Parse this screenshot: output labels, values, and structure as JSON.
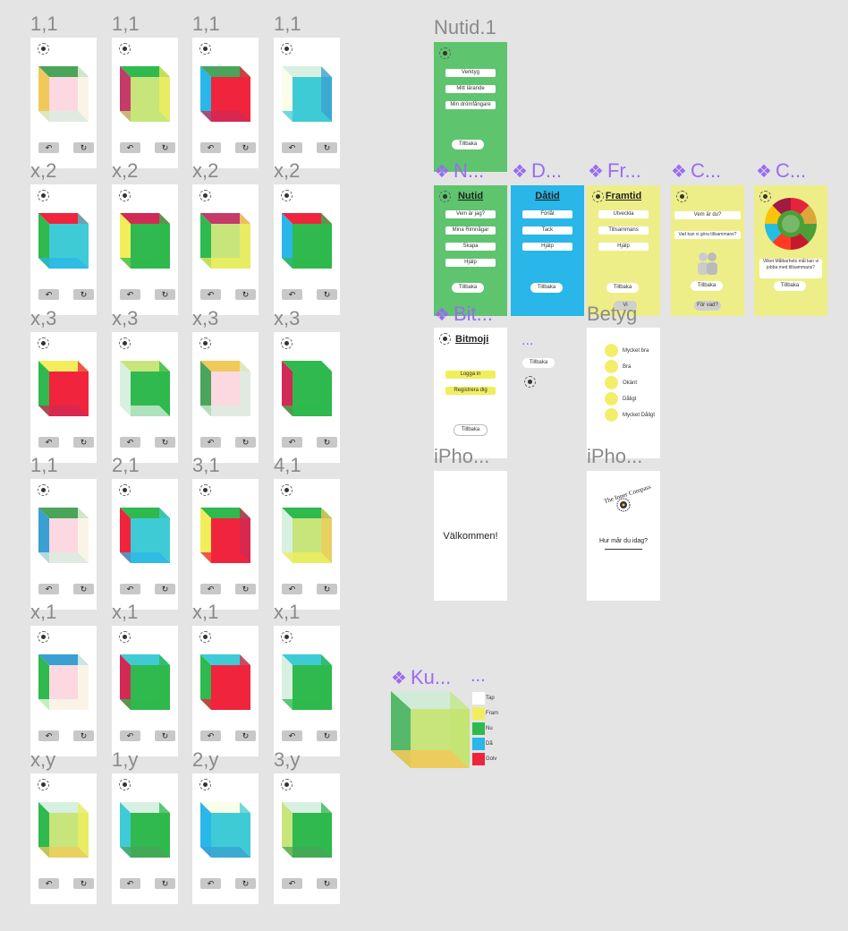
{
  "canvas": {
    "cube_frames": {
      "rows": [
        {
          "labels": [
            "1,1",
            "1,1",
            "1,1",
            "1,1"
          ]
        },
        {
          "labels": [
            "x,2",
            "x,2",
            "x,2",
            "x,2"
          ]
        },
        {
          "labels": [
            "x,3",
            "x,3",
            "x,3",
            "x,3"
          ]
        },
        {
          "labels": [
            "1,1",
            "2,1",
            "3,1",
            "4,1"
          ]
        },
        {
          "labels": [
            "x,1",
            "x,1",
            "x,1",
            "x,1"
          ]
        },
        {
          "labels": [
            "x,y",
            "1,y",
            "2,y",
            "3,y"
          ]
        }
      ],
      "button_icons": [
        "↶",
        "↻"
      ]
    },
    "nutid1": {
      "label": "Nutid.1",
      "buttons": [
        "Verktyg",
        "Mitt lärande",
        "Min drömfångare"
      ],
      "back": "Tillbaka",
      "color": "#5ec46e"
    },
    "components": [
      {
        "label": "N...",
        "title": "Nutid",
        "color": "#5ec46e",
        "buttons": [
          "Vem är jag?",
          "Mina Rimnågar",
          "Skapa",
          "Hjälp"
        ],
        "back": "Tillbaka"
      },
      {
        "label": "D...",
        "title": "Dåtid",
        "color": "#29b6e8",
        "buttons": [
          "Förlåt",
          "Tack",
          "Hjälp"
        ],
        "back": "Tillbaka"
      },
      {
        "label": "Fr...",
        "title": "Framtid",
        "color": "#eeee88",
        "buttons": [
          "Utveckla",
          "Tillsammans",
          "Hjälp"
        ],
        "back": "Tillbaka",
        "extra": "Vi"
      },
      {
        "label": "C...",
        "color": "#eeee88",
        "buttons": [
          "Vem är du?",
          "Vad kan vi göra tillsammans?"
        ],
        "back": "Tillbaka",
        "extra": "För vad?"
      },
      {
        "label": "C...",
        "color": "#eeee88",
        "question": "Vilket Målbarhets mål kan vi jobba med tillsammans?",
        "back": "Tillbaka"
      }
    ],
    "bitmoji": {
      "label": "Bit...",
      "title": "Bitmoji",
      "buttons": [
        "Logga in",
        "Registrera dig"
      ],
      "back": "Tillbaka"
    },
    "small": {
      "label": "...",
      "back": "Tillbaka"
    },
    "betyg": {
      "label": "Betyg",
      "items": [
        "Mycket bra",
        "Bra",
        "Okänt",
        "Dåligt",
        "Mycket Dåligt"
      ]
    },
    "iphone1": {
      "label": "iPho...",
      "text": "Välkommen!"
    },
    "iphone2": {
      "label": "iPho...",
      "brand": "The Inner Compass",
      "question": "Hur mår du idag?"
    },
    "kub": {
      "label": "Ku...",
      "legend_label": "...",
      "legend": [
        {
          "name": "Tap",
          "color": "#ffffff"
        },
        {
          "name": "Fram",
          "color": "#f1ee5c"
        },
        {
          "name": "Nu",
          "color": "#2fb94e"
        },
        {
          "name": "Då",
          "color": "#29b6e8"
        },
        {
          "name": "Golv",
          "color": "#f0243c"
        }
      ]
    }
  }
}
